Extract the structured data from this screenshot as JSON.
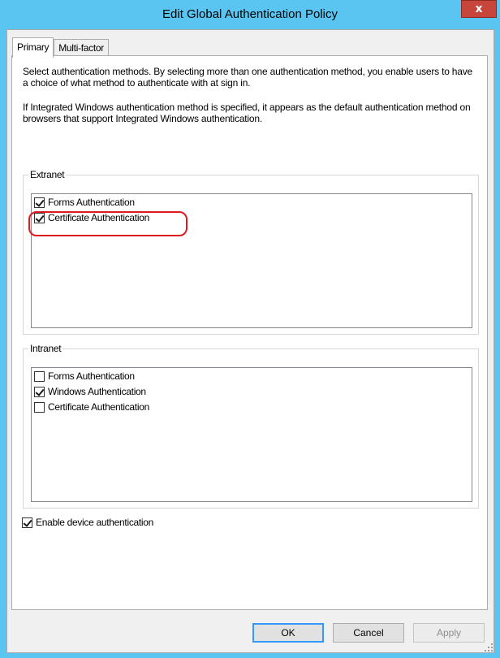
{
  "window": {
    "title": "Edit Global Authentication Policy",
    "close_glyph": "x"
  },
  "tabs": [
    {
      "label": "Primary",
      "active": true
    },
    {
      "label": "Multi-factor",
      "active": false
    }
  ],
  "description": {
    "paragraph1": "Select authentication methods. By selecting more than one authentication method, you enable users to have a choice of what method to authenticate with at sign in.",
    "paragraph2": "If Integrated Windows authentication method is specified, it appears as the default authentication method on browsers that support Integrated Windows authentication."
  },
  "extranet": {
    "label": "Extranet",
    "items": [
      {
        "label": "Forms Authentication",
        "checked": true
      },
      {
        "label": "Certificate Authentication",
        "checked": true
      }
    ]
  },
  "intranet": {
    "label": "Intranet",
    "items": [
      {
        "label": "Forms Authentication",
        "checked": false
      },
      {
        "label": "Windows Authentication",
        "checked": true
      },
      {
        "label": "Certificate Authentication",
        "checked": false
      }
    ]
  },
  "device_auth": {
    "label": "Enable device authentication",
    "checked": true
  },
  "buttons": {
    "ok": "OK",
    "cancel": "Cancel",
    "apply": "Apply"
  },
  "colors": {
    "title_bar": "#59c5f0",
    "close_button": "#c7453a",
    "highlight_annotation": "#e0191f"
  }
}
